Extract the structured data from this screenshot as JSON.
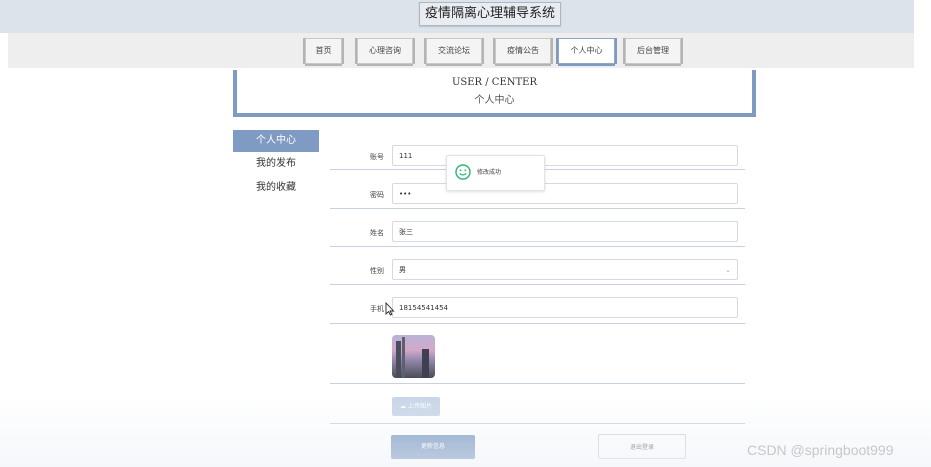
{
  "app": {
    "title": "疫情隔离心理辅导系统"
  },
  "nav": [
    {
      "label": "首页"
    },
    {
      "label": "心理咨询"
    },
    {
      "label": "交流论坛"
    },
    {
      "label": "疫情公告"
    },
    {
      "label": "个人中心",
      "active": true
    },
    {
      "label": "后台管理"
    }
  ],
  "banner": {
    "en": "USER / CENTER",
    "cn": "个人中心"
  },
  "sidebar": [
    {
      "label": "个人中心",
      "active": true
    },
    {
      "label": "我的发布"
    },
    {
      "label": "我的收藏"
    }
  ],
  "form": {
    "account_label": "账号",
    "account_value": "111",
    "password_label": "密码",
    "password_value": "•••",
    "name_label": "姓名",
    "name_value": "张三",
    "gender_label": "性别",
    "gender_value": "男",
    "phone_label": "手机",
    "phone_value": "18154541454",
    "upload_label": "上传图片",
    "update_label": "更新信息",
    "logout_label": "退出登录"
  },
  "toast": {
    "message": "修改成功"
  },
  "watermark": "CSDN @springboot999",
  "colors": {
    "accent": "#7f9bc3",
    "header": "#dde3eb",
    "nav": "#eeeeee"
  },
  "icons": {
    "toast": "smile-icon",
    "upload": "cloud-upload-icon",
    "select": "chevron-down-icon"
  }
}
